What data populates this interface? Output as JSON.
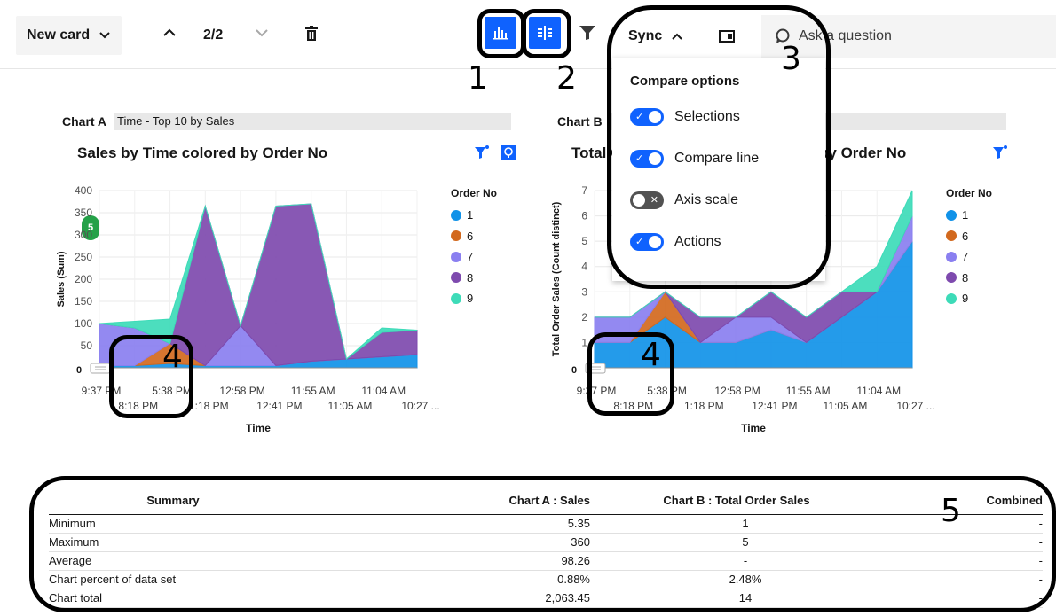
{
  "toolbar": {
    "new_card_label": "New card",
    "page_indicator": "2/2",
    "sync_label": "Sync",
    "ask_placeholder": "Ask a question"
  },
  "annotations": {
    "n1": "1",
    "n2": "2",
    "n3": "3",
    "n4a": "4",
    "n4b": "4",
    "n5": "5"
  },
  "compare_options": {
    "title": "Compare options",
    "options": [
      {
        "label": "Selections",
        "on": true
      },
      {
        "label": "Compare line",
        "on": true
      },
      {
        "label": "Axis scale",
        "on": false
      },
      {
        "label": "Actions",
        "on": true
      }
    ]
  },
  "chart_a": {
    "label": "Chart A",
    "description": "Time - Top 10 by Sales",
    "title": "Sales by Time colored by Order No",
    "badge": "5",
    "handle_value": "0"
  },
  "chart_b": {
    "label": "Chart B",
    "title": "Total Order Sales by Time colored by Order No",
    "handle_value": "0"
  },
  "legend": {
    "title": "Order No",
    "items": [
      {
        "label": "1",
        "color": "#1192e8"
      },
      {
        "label": "6",
        "color": "#d2691e"
      },
      {
        "label": "7",
        "color": "#8a7ff0"
      },
      {
        "label": "8",
        "color": "#7e4aae"
      },
      {
        "label": "9",
        "color": "#3ddbb8"
      }
    ]
  },
  "chart_data": [
    {
      "type": "area",
      "title": "Sales by Time colored by Order No",
      "xlabel": "Time",
      "ylabel": "Sales (Sum)",
      "ylim": [
        0,
        400
      ],
      "yticks": [
        "0",
        "50",
        "100",
        "150",
        "200",
        "250",
        "300",
        "350",
        "400"
      ],
      "categories": [
        "9:37 PM",
        "8:18 PM",
        "5:38 PM",
        "1:18 PM",
        "12:58 PM",
        "12:41 PM",
        "11:55 AM",
        "11:05 AM",
        "11:04 AM",
        "10:27 ..."
      ],
      "xlabels_row1": [
        "9:37 PM",
        "5:38 PM",
        "12:58 PM",
        "11:55 AM",
        "11:04 AM"
      ],
      "xlabels_row2": [
        "8:18 PM",
        "1:18 PM",
        "12:41 PM",
        "11:05 AM",
        "10:27 ..."
      ],
      "series": [
        {
          "name": "1",
          "values": [
            5,
            5,
            10,
            5,
            5,
            5,
            15,
            20,
            25,
            30
          ]
        },
        {
          "name": "6",
          "values": [
            0,
            0,
            45,
            0,
            0,
            0,
            0,
            0,
            0,
            0
          ]
        },
        {
          "name": "7",
          "values": [
            95,
            85,
            0,
            0,
            90,
            0,
            0,
            0,
            0,
            0
          ]
        },
        {
          "name": "8",
          "values": [
            0,
            0,
            0,
            360,
            0,
            360,
            355,
            0,
            55,
            55
          ]
        },
        {
          "name": "9",
          "values": [
            0,
            15,
            55,
            0,
            0,
            0,
            0,
            0,
            10,
            0
          ]
        }
      ]
    },
    {
      "type": "area",
      "title": "Total Order Sales by Time colored by Order No",
      "xlabel": "Time",
      "ylabel": "Total Order Sales (Count distinct)",
      "ylim": [
        0,
        7
      ],
      "yticks": [
        "0",
        "1",
        "2",
        "3",
        "4",
        "5",
        "6",
        "7"
      ],
      "categories": [
        "9:37 PM",
        "8:18 PM",
        "5:38 PM",
        "1:18 PM",
        "12:58 PM",
        "12:41 PM",
        "11:55 AM",
        "11:05 AM",
        "11:04 AM",
        "10:27 ..."
      ],
      "xlabels_row1": [
        "9:37 PM",
        "5:38 PM",
        "12:58 PM",
        "11:55 AM",
        "11:04 AM"
      ],
      "xlabels_row2": [
        "8:18 PM",
        "1:18 PM",
        "12:41 PM",
        "11:05 AM",
        "10:27 ..."
      ],
      "series": [
        {
          "name": "1",
          "values": [
            1,
            1,
            2,
            1,
            1,
            1.5,
            1,
            2,
            3,
            5
          ]
        },
        {
          "name": "6",
          "values": [
            0,
            0,
            1,
            0,
            0,
            0,
            0,
            0,
            0,
            0
          ]
        },
        {
          "name": "7",
          "values": [
            1,
            1,
            0,
            0,
            1,
            0.5,
            0,
            0,
            0,
            1
          ]
        },
        {
          "name": "8",
          "values": [
            0,
            0,
            0,
            1,
            0,
            1,
            1,
            1,
            0,
            0
          ]
        },
        {
          "name": "9",
          "values": [
            0,
            0,
            0,
            0,
            0,
            0,
            0,
            0,
            1,
            1
          ]
        }
      ]
    }
  ],
  "summary": {
    "headers": [
      "Summary",
      "Chart A : Sales",
      "Chart B : Total Order Sales",
      "Combined"
    ],
    "rows": [
      [
        "Minimum",
        "5.35",
        "1",
        "-"
      ],
      [
        "Maximum",
        "360",
        "5",
        "-"
      ],
      [
        "Average",
        "98.26",
        "-",
        "-"
      ],
      [
        "Chart percent of data set",
        "0.88%",
        "2.48%",
        "-"
      ],
      [
        "Chart total",
        "2,063.45",
        "14",
        "-"
      ]
    ]
  }
}
